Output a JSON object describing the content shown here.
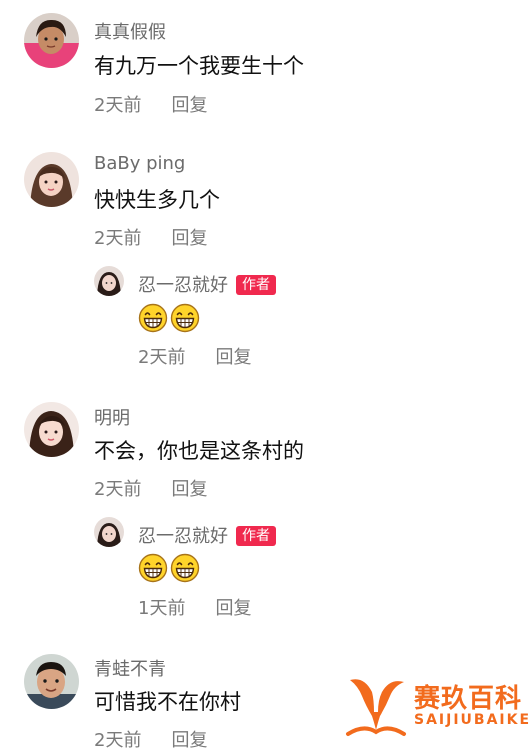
{
  "colors": {
    "author_badge_bg": "#f0294e",
    "username": "#6b6b6b",
    "meta": "#7a7a7a",
    "watermark": "#f26b1d"
  },
  "comments": [
    {
      "username": "真真假假",
      "content": "有九万一个我要生十个",
      "time": "2天前",
      "reply_label": "回复",
      "avatar_icon": "child-girl-avatar-icon"
    },
    {
      "username": "BaBy ping",
      "content": "快快生多几个",
      "time": "2天前",
      "reply_label": "回复",
      "avatar_icon": "girl-avatar-icon",
      "replies": [
        {
          "username": "忍一忍就好",
          "badge": "作者",
          "emojis": [
            "grinning-face-icon",
            "grinning-face-icon"
          ],
          "time": "2天前",
          "reply_label": "回复",
          "avatar_icon": "author-avatar-icon"
        }
      ]
    },
    {
      "username": "明明",
      "content": "不会，你也是这条村的",
      "time": "2天前",
      "reply_label": "回复",
      "avatar_icon": "girl-avatar-icon",
      "replies": [
        {
          "username": "忍一忍就好",
          "badge": "作者",
          "emojis": [
            "grinning-face-icon",
            "grinning-face-icon"
          ],
          "time": "1天前",
          "reply_label": "回复",
          "avatar_icon": "author-avatar-icon"
        }
      ]
    },
    {
      "username": "青蛙不青",
      "content": "可惜我不在你村",
      "time": "2天前",
      "reply_label": "回复",
      "avatar_icon": "boy-avatar-icon"
    }
  ],
  "watermark": {
    "text_cn": "赛玖百科",
    "text_en": "SAIJIUBAIKE",
    "logo_icon": "whale-tail-logo-icon"
  }
}
